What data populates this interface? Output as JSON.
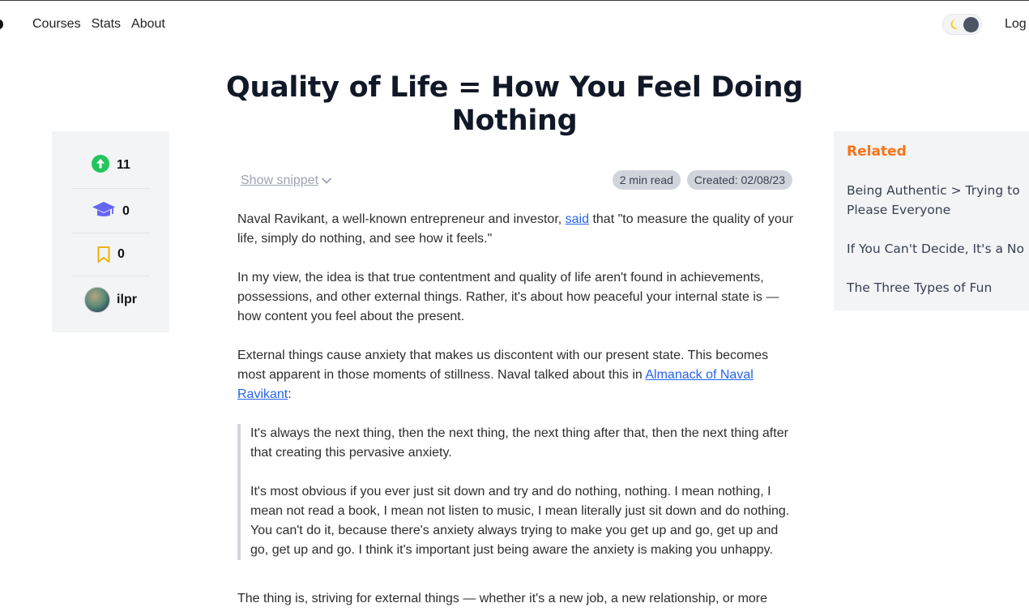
{
  "nav": {
    "items": [
      "Courses",
      "Stats",
      "About"
    ],
    "login_label": "Log"
  },
  "title": "Quality of Life = How You Feel Doing Nothing",
  "stats": {
    "upvotes": "11",
    "courses": "0",
    "bookmarks": "0",
    "author": "ilpr"
  },
  "meta": {
    "snippet_label": "Show snippet",
    "read_time": "2 min read",
    "created": "Created: 02/08/23"
  },
  "article": {
    "p1_before": "Naval Ravikant, a well-known entrepreneur and investor, ",
    "p1_link": "said",
    "p1_after": " that \"to measure the quality of your life, simply do nothing, and see how it feels.\"",
    "p2": "In my view, the idea is that true contentment and quality of life aren't found in achievements, possessions, and other external things. Rather, it's about how peaceful your internal state is — how content you feel about the present.",
    "p3_before": "External things cause anxiety that makes us discontent with our present state. This becomes most apparent in those moments of stillness. Naval talked about this in ",
    "p3_link": "Almanack of Naval Ravikant",
    "p3_after": ":",
    "quote1": "It's always the next thing, then the next thing, the next thing after that, then the next thing after that creating this pervasive anxiety.",
    "quote2": "It's most obvious if you ever just sit down and try and do nothing, nothing. I mean nothing, I mean not read a book, I mean not listen to music, I mean literally just sit down and do nothing. You can't do it, because there's anxiety always trying to make you get up and go, get up and go, get up and go. I think it's important just being aware the anxiety is making you unhappy.",
    "p4": "The thing is, striving for external things — whether it's a new job, a new relationship, or more"
  },
  "related": {
    "heading": "Related",
    "items": [
      "Being Authentic > Trying to Please Everyone",
      "If You Can't Decide, It's a No",
      "The Three Types of Fun"
    ]
  },
  "colors": {
    "accent": "#f97316",
    "link": "#2563eb",
    "upvote": "#22c55e",
    "courses_icon": "#6366f1",
    "bookmark": "#eab308",
    "panel_bg": "#f3f4f6"
  },
  "icons": [
    "upvote-icon",
    "graduation-cap-icon",
    "bookmark-icon",
    "moon-icon",
    "chevron-down-icon"
  ]
}
